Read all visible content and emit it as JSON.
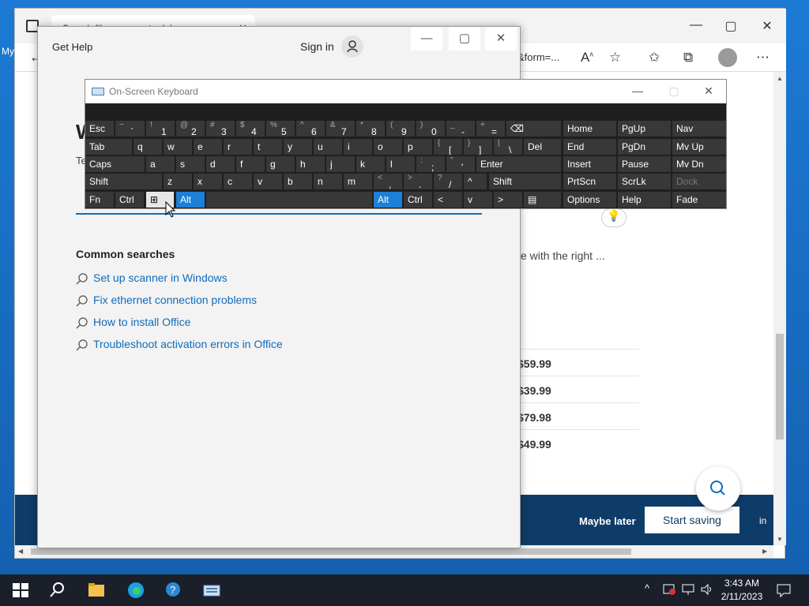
{
  "desktop": {
    "icon_label": "My"
  },
  "browser": {
    "tab_title": "Search files - computer labs",
    "url_tail": "&form=...",
    "desc_tail": "e with the right ...",
    "prices": [
      "$59.99",
      "$39.99",
      "$79.98",
      "$49.99"
    ],
    "banner": {
      "maybe_later": "Maybe later",
      "start_saving": "Start saving",
      "tail": "in"
    }
  },
  "get_help": {
    "title": "Get Help",
    "sign_in": "Sign in",
    "heading_part": "W",
    "sub_part": "Te",
    "common_searches_label": "Common searches",
    "searches": [
      "Set up scanner in Windows",
      "Fix ethernet connection problems",
      "How to install Office",
      "Troubleshoot activation errors in Office"
    ]
  },
  "osk": {
    "title": "On-Screen Keyboard",
    "rows": [
      [
        {
          "l": "Esc"
        },
        {
          "s": "~",
          "m": "`"
        },
        {
          "s": "!",
          "m": "1"
        },
        {
          "s": "@",
          "m": "2"
        },
        {
          "s": "#",
          "m": "3"
        },
        {
          "s": "$",
          "m": "4"
        },
        {
          "s": "%",
          "m": "5"
        },
        {
          "s": "^",
          "m": "6"
        },
        {
          "s": "&",
          "m": "7"
        },
        {
          "s": "*",
          "m": "8"
        },
        {
          "s": "(",
          "m": "9"
        },
        {
          "s": ")",
          "m": "0"
        },
        {
          "s": "_",
          "m": "-"
        },
        {
          "s": "+",
          "m": "="
        },
        {
          "l": "⌫"
        },
        {
          "l": "Home"
        },
        {
          "l": "PgUp"
        },
        {
          "l": "Nav"
        }
      ],
      [
        {
          "l": "Tab"
        },
        {
          "l": "q"
        },
        {
          "l": "w"
        },
        {
          "l": "e"
        },
        {
          "l": "r"
        },
        {
          "l": "t"
        },
        {
          "l": "y"
        },
        {
          "l": "u"
        },
        {
          "l": "i"
        },
        {
          "l": "o"
        },
        {
          "l": "p"
        },
        {
          "s": "{",
          "m": "["
        },
        {
          "s": "}",
          "m": "]"
        },
        {
          "s": "|",
          "m": "\\"
        },
        {
          "l": "Del"
        },
        {
          "l": "End"
        },
        {
          "l": "PgDn"
        },
        {
          "l": "Mv Up"
        }
      ],
      [
        {
          "l": "Caps"
        },
        {
          "l": "a"
        },
        {
          "l": "s"
        },
        {
          "l": "d"
        },
        {
          "l": "f"
        },
        {
          "l": "g"
        },
        {
          "l": "h"
        },
        {
          "l": "j"
        },
        {
          "l": "k"
        },
        {
          "l": "l"
        },
        {
          "s": ":",
          "m": ";"
        },
        {
          "s": "\"",
          "m": "'"
        },
        {
          "l": "Enter"
        },
        {
          "l": "Insert"
        },
        {
          "l": "Pause"
        },
        {
          "l": "Mv Dn"
        }
      ],
      [
        {
          "l": "Shift"
        },
        {
          "l": "z"
        },
        {
          "l": "x"
        },
        {
          "l": "c"
        },
        {
          "l": "v"
        },
        {
          "l": "b"
        },
        {
          "l": "n"
        },
        {
          "l": "m"
        },
        {
          "s": "<",
          "m": ","
        },
        {
          "s": ">",
          "m": "."
        },
        {
          "s": "?",
          "m": "/"
        },
        {
          "l": "^"
        },
        {
          "l": "Shift"
        },
        {
          "l": "PrtScn"
        },
        {
          "l": "ScrLk"
        },
        {
          "l": "Dock"
        }
      ],
      [
        {
          "l": "Fn"
        },
        {
          "l": "Ctrl"
        },
        {
          "l": "⊞"
        },
        {
          "l": "Alt"
        },
        {
          "l": ""
        },
        {
          "l": "Alt"
        },
        {
          "l": "Ctrl"
        },
        {
          "l": "<"
        },
        {
          "l": "v"
        },
        {
          "l": ">"
        },
        {
          "l": "▤"
        },
        {
          "l": "Options"
        },
        {
          "l": "Help"
        },
        {
          "l": "Fade"
        }
      ]
    ]
  },
  "taskbar": {
    "time": "3:43 AM",
    "date": "2/11/2023"
  },
  "colors": {
    "accent": "#0f6cbd",
    "osk_blue": "#1e7fd6",
    "banner": "#0e3c68",
    "taskbar": "#1a1f2a"
  }
}
